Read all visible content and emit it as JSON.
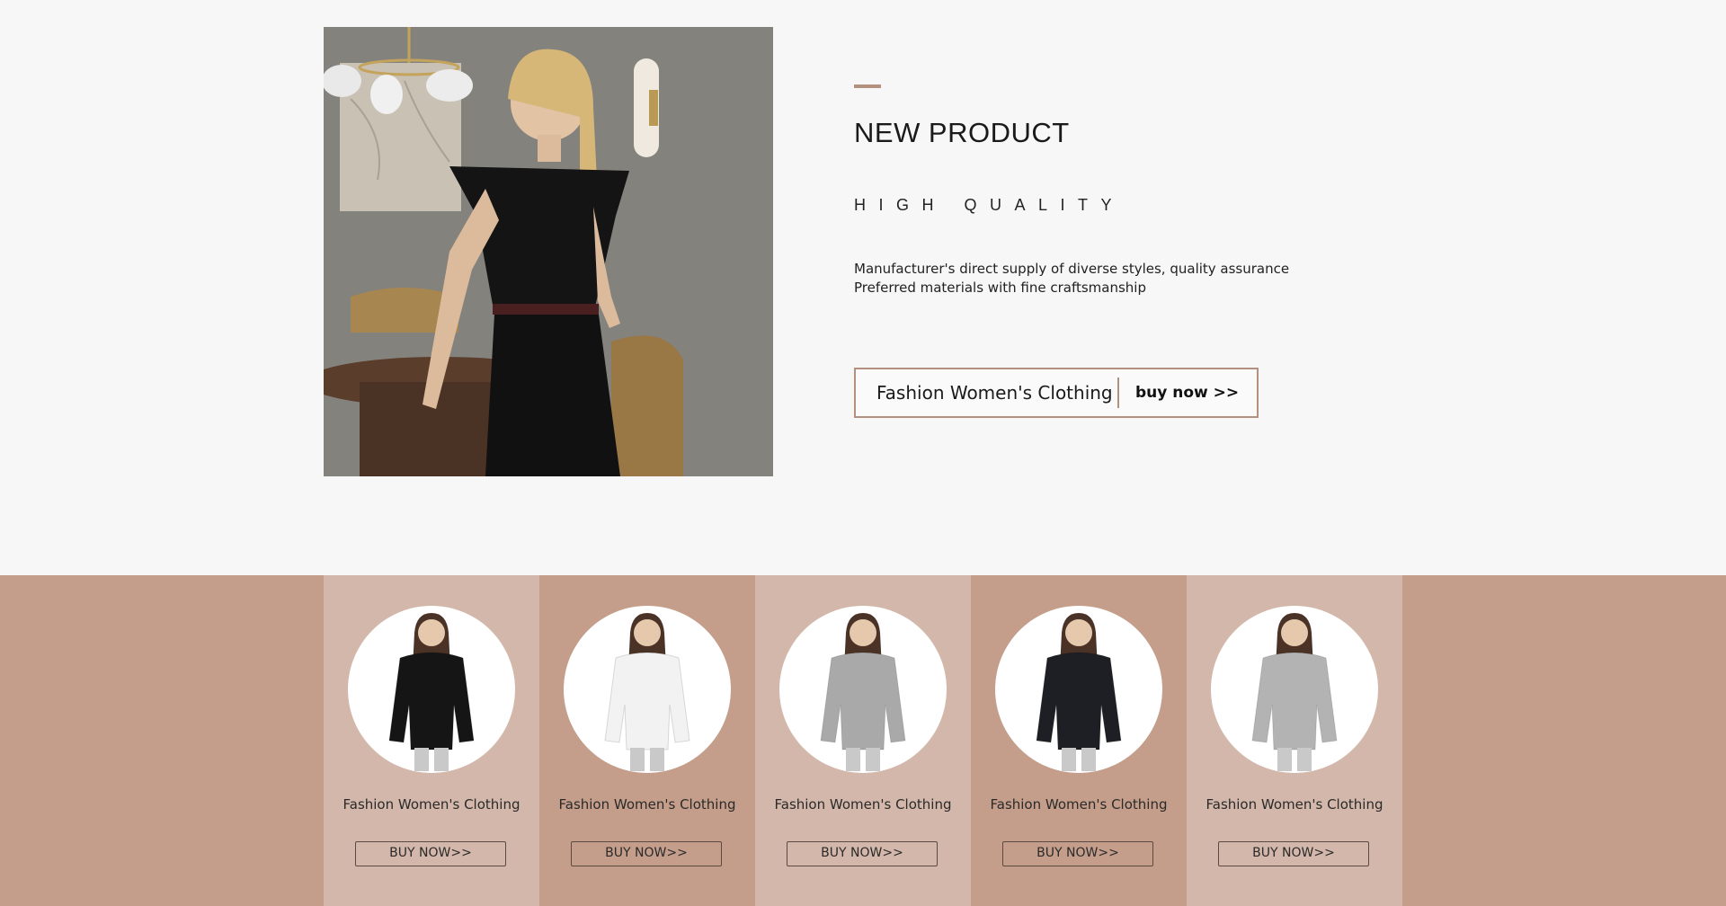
{
  "hero": {
    "title": "NEW PRODUCT",
    "subtitle": "HIGH QUALITY",
    "description": [
      "Manufacturer's direct supply of diverse styles, quality assurance",
      "Preferred materials with fine craftsmanship"
    ],
    "cta_label": "Fashion Women's Clothing",
    "cta_link": "buy now >>"
  },
  "products": [
    {
      "title": "Fashion Women's Clothing",
      "button": "BUY NOW>>",
      "garment_color": "#151515"
    },
    {
      "title": "Fashion Women's Clothing",
      "button": "BUY NOW>>",
      "garment_color": "#f2f2f2"
    },
    {
      "title": "Fashion Women's Clothing",
      "button": "BUY NOW>>",
      "garment_color": "#a9a9a9"
    },
    {
      "title": "Fashion Women's Clothing",
      "button": "BUY NOW>>",
      "garment_color": "#1e1f24"
    },
    {
      "title": "Fashion Women's Clothing",
      "button": "BUY NOW>>",
      "garment_color": "#b3b3b3"
    }
  ],
  "colors": {
    "accent": "#b2917f",
    "strip_dark": "#c49e8a",
    "strip_light": "#d3b7aa"
  }
}
